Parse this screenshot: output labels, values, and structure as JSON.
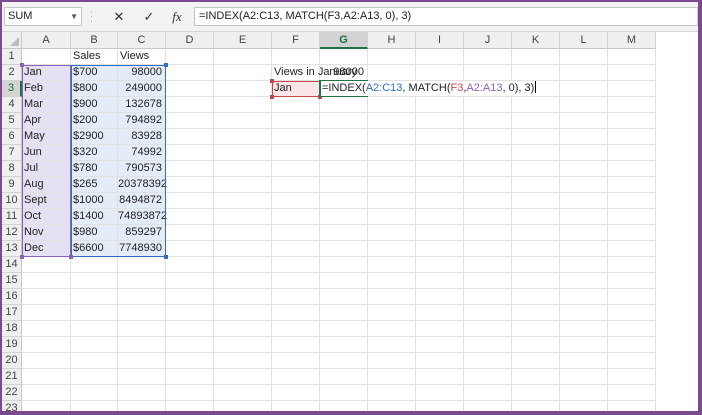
{
  "formula_bar": {
    "name_box": "SUM",
    "cancel_icon": "✕",
    "enter_icon": "✓",
    "fx_label": "fx",
    "formula": "=INDEX(A2:C13, MATCH(F3,A2:A13, 0), 3)"
  },
  "columns": [
    "A",
    "B",
    "C",
    "D",
    "E",
    "F",
    "G",
    "H",
    "I",
    "J",
    "K",
    "L",
    "M"
  ],
  "rows": [
    "1",
    "2",
    "3",
    "4",
    "5",
    "6",
    "7",
    "8",
    "9",
    "10",
    "11",
    "12",
    "13",
    "14",
    "15",
    "16",
    "17",
    "18",
    "19",
    "20",
    "21",
    "22",
    "23"
  ],
  "headers": {
    "sales": "Sales",
    "views": "Views"
  },
  "table": [
    {
      "month": "Jan",
      "sales": "$700",
      "views": "98000"
    },
    {
      "month": "Feb",
      "sales": "$800",
      "views": "249000"
    },
    {
      "month": "Mar",
      "sales": "$900",
      "views": "132678"
    },
    {
      "month": "Apr",
      "sales": "$200",
      "views": "794892"
    },
    {
      "month": "May",
      "sales": "$2900",
      "views": "83928"
    },
    {
      "month": "Jun",
      "sales": "$320",
      "views": "74992"
    },
    {
      "month": "Jul",
      "sales": "$780",
      "views": "790573"
    },
    {
      "month": "Aug",
      "sales": "$265",
      "views": "20378392"
    },
    {
      "month": "Sept",
      "sales": "$1000",
      "views": "8494872"
    },
    {
      "month": "Oct",
      "sales": "$1400",
      "views": "74893872"
    },
    {
      "month": "Nov",
      "sales": "$980",
      "views": "859297"
    },
    {
      "month": "Dec",
      "sales": "$6600",
      "views": "7748930"
    }
  ],
  "lookup": {
    "label": "Views in January",
    "value": "98000",
    "input": "Jan"
  },
  "editing_formula_parts": [
    "=INDEX(",
    "A2:C13",
    ", MATCH(",
    "F3",
    ",",
    "A2:A13",
    ", 0), 3)"
  ],
  "selection": {
    "active_column": "G",
    "active_row": "3"
  },
  "colors": {
    "accent_green": "#217346",
    "range_blue": "#2f6fbd",
    "range_red": "#c74848",
    "range_purple": "#8a62b8",
    "window_border": "#7b4a8f"
  }
}
